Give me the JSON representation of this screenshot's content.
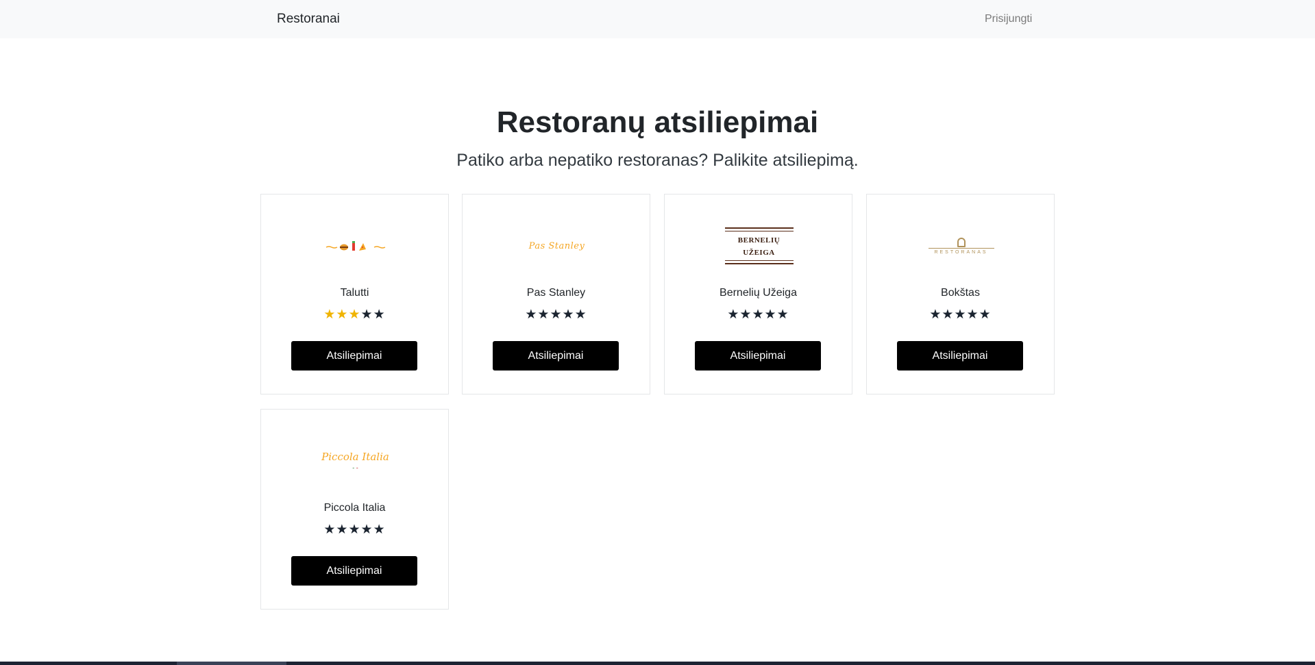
{
  "navbar": {
    "brand": "Restoranai",
    "login": "Prisijungti"
  },
  "hero": {
    "title": "Restoranų atsiliepimai",
    "subtitle": "Patiko arba nepatiko restoranas? Palikite atsiliepimą."
  },
  "restaurants": [
    {
      "name": "Talutti",
      "rating": 3,
      "max_rating": 5,
      "button_label": "Atsiliepimai",
      "logo_icon": "talutti-logo"
    },
    {
      "name": "Pas Stanley",
      "rating": 0,
      "max_rating": 5,
      "button_label": "Atsiliepimai",
      "logo_icon": "pas-stanley-logo",
      "logo_text": "Pas Stanley"
    },
    {
      "name": "Bernelių Užeiga",
      "rating": 0,
      "max_rating": 5,
      "button_label": "Atsiliepimai",
      "logo_icon": "berneliu-uzeiga-logo",
      "logo_text": "BERNELIŲ UŽEIGA"
    },
    {
      "name": "Bokštas",
      "rating": 0,
      "max_rating": 5,
      "button_label": "Atsiliepimai",
      "logo_icon": "bokstas-logo",
      "logo_text": "RESTORANAS"
    },
    {
      "name": "Piccola Italia",
      "rating": 0,
      "max_rating": 5,
      "button_label": "Atsiliepimai",
      "logo_icon": "piccola-italia-logo",
      "logo_text": "Piccola Italia"
    }
  ],
  "colors": {
    "navbar_bg": "#f8f9fa",
    "star_filled": "#f0b400",
    "star_empty": "#1b2430",
    "button_bg": "#000000",
    "logo_orange": "#f5a623",
    "logo_brown": "#5a2e1a",
    "logo_gold": "#b0925a"
  }
}
